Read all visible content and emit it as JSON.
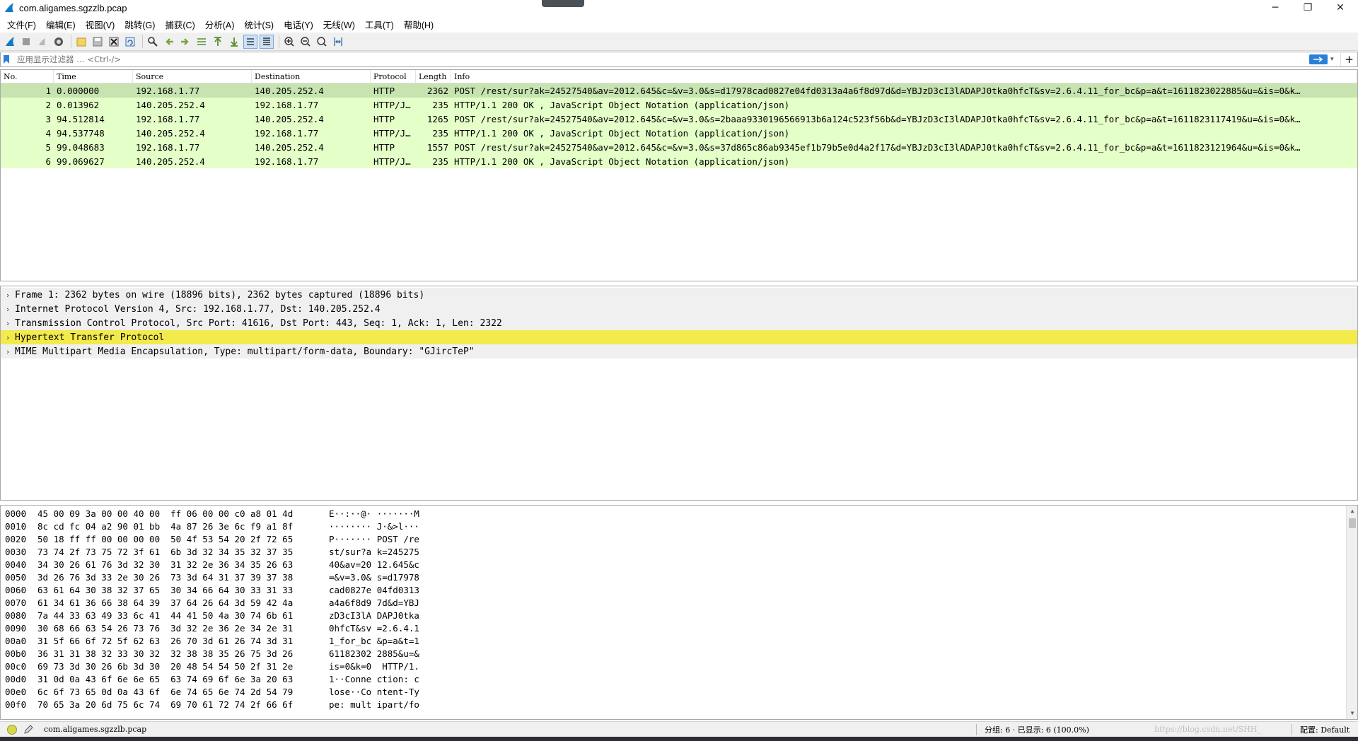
{
  "window": {
    "title": "com.aligames.sgzzlb.pcap",
    "minimize_glyph": "─",
    "restore_glyph": "❐",
    "close_glyph": "✕"
  },
  "menu": [
    "文件(F)",
    "编辑(E)",
    "视图(V)",
    "跳转(G)",
    "捕获(C)",
    "分析(A)",
    "统计(S)",
    "电话(Y)",
    "无线(W)",
    "工具(T)",
    "帮助(H)"
  ],
  "filter": {
    "placeholder": "应用显示过滤器 … <Ctrl-/>",
    "plus": "+"
  },
  "packet_list": {
    "columns": [
      "No.",
      "Time",
      "Source",
      "Destination",
      "Protocol",
      "Length",
      "Info"
    ],
    "rows": [
      {
        "no": "1",
        "time": "0.000000",
        "src": "192.168.1.77",
        "dst": "140.205.252.4",
        "proto": "HTTP",
        "len": "2362",
        "info": "POST /rest/sur?ak=24527540&av=2012.645&c=&v=3.0&s=d17978cad0827e04fd0313a4a6f8d97d&d=YBJzD3cI3lADAPJ0tka0hfcT&sv=2.6.4.11_for_bc&p=a&t=1611823022885&u=&is=0&k…"
      },
      {
        "no": "2",
        "time": "0.013962",
        "src": "140.205.252.4",
        "dst": "192.168.1.77",
        "proto": "HTTP/J…",
        "len": "235",
        "info": "HTTP/1.1 200 OK , JavaScript Object Notation (application/json)"
      },
      {
        "no": "3",
        "time": "94.512814",
        "src": "192.168.1.77",
        "dst": "140.205.252.4",
        "proto": "HTTP",
        "len": "1265",
        "info": "POST /rest/sur?ak=24527540&av=2012.645&c=&v=3.0&s=2baaa9330196566913b6a124c523f56b&d=YBJzD3cI3lADAPJ0tka0hfcT&sv=2.6.4.11_for_bc&p=a&t=1611823117419&u=&is=0&k…"
      },
      {
        "no": "4",
        "time": "94.537748",
        "src": "140.205.252.4",
        "dst": "192.168.1.77",
        "proto": "HTTP/J…",
        "len": "235",
        "info": "HTTP/1.1 200 OK , JavaScript Object Notation (application/json)"
      },
      {
        "no": "5",
        "time": "99.048683",
        "src": "192.168.1.77",
        "dst": "140.205.252.4",
        "proto": "HTTP",
        "len": "1557",
        "info": "POST /rest/sur?ak=24527540&av=2012.645&c=&v=3.0&s=37d865c86ab9345ef1b79b5e0d4a2f17&d=YBJzD3cI3lADAPJ0tka0hfcT&sv=2.6.4.11_for_bc&p=a&t=1611823121964&u=&is=0&k…"
      },
      {
        "no": "6",
        "time": "99.069627",
        "src": "140.205.252.4",
        "dst": "192.168.1.77",
        "proto": "HTTP/J…",
        "len": "235",
        "info": "HTTP/1.1 200 OK , JavaScript Object Notation (application/json)"
      }
    ]
  },
  "details": [
    "Frame 1: 2362 bytes on wire (18896 bits), 2362 bytes captured (18896 bits)",
    "Internet Protocol Version 4, Src: 192.168.1.77, Dst: 140.205.252.4",
    "Transmission Control Protocol, Src Port: 41616, Dst Port: 443, Seq: 1, Ack: 1, Len: 2322",
    "Hypertext Transfer Protocol",
    "MIME Multipart Media Encapsulation, Type: multipart/form-data, Boundary: \"GJircTeP\""
  ],
  "hex": [
    {
      "off": "0000",
      "bytes": "45 00 09 3a 00 00 40 00  ff 06 00 00 c0 a8 01 4d",
      "ascii": "E··:··@· ·······M"
    },
    {
      "off": "0010",
      "bytes": "8c cd fc 04 a2 90 01 bb  4a 87 26 3e 6c f9 a1 8f",
      "ascii": "········ J·&>l···"
    },
    {
      "off": "0020",
      "bytes": "50 18 ff ff 00 00 00 00  50 4f 53 54 20 2f 72 65",
      "ascii": "P······· POST /re"
    },
    {
      "off": "0030",
      "bytes": "73 74 2f 73 75 72 3f 61  6b 3d 32 34 35 32 37 35",
      "ascii": "st/sur?a k=245275"
    },
    {
      "off": "0040",
      "bytes": "34 30 26 61 76 3d 32 30  31 32 2e 36 34 35 26 63",
      "ascii": "40&av=20 12.645&c"
    },
    {
      "off": "0050",
      "bytes": "3d 26 76 3d 33 2e 30 26  73 3d 64 31 37 39 37 38",
      "ascii": "=&v=3.0& s=d17978"
    },
    {
      "off": "0060",
      "bytes": "63 61 64 30 38 32 37 65  30 34 66 64 30 33 31 33",
      "ascii": "cad0827e 04fd0313"
    },
    {
      "off": "0070",
      "bytes": "61 34 61 36 66 38 64 39  37 64 26 64 3d 59 42 4a",
      "ascii": "a4a6f8d9 7d&d=YBJ"
    },
    {
      "off": "0080",
      "bytes": "7a 44 33 63 49 33 6c 41  44 41 50 4a 30 74 6b 61",
      "ascii": "zD3cI3lA DAPJ0tka"
    },
    {
      "off": "0090",
      "bytes": "30 68 66 63 54 26 73 76  3d 32 2e 36 2e 34 2e 31",
      "ascii": "0hfcT&sv =2.6.4.1"
    },
    {
      "off": "00a0",
      "bytes": "31 5f 66 6f 72 5f 62 63  26 70 3d 61 26 74 3d 31",
      "ascii": "1_for_bc &p=a&t=1"
    },
    {
      "off": "00b0",
      "bytes": "36 31 31 38 32 33 30 32  32 38 38 35 26 75 3d 26",
      "ascii": "61182302 2885&u=&"
    },
    {
      "off": "00c0",
      "bytes": "69 73 3d 30 26 6b 3d 30  20 48 54 54 50 2f 31 2e",
      "ascii": "is=0&k=0  HTTP/1."
    },
    {
      "off": "00d0",
      "bytes": "31 0d 0a 43 6f 6e 6e 65  63 74 69 6f 6e 3a 20 63",
      "ascii": "1··Conne ction: c"
    },
    {
      "off": "00e0",
      "bytes": "6c 6f 73 65 0d 0a 43 6f  6e 74 65 6e 74 2d 54 79",
      "ascii": "lose··Co ntent-Ty"
    },
    {
      "off": "00f0",
      "bytes": "70 65 3a 20 6d 75 6c 74  69 70 61 72 74 2f 66 6f",
      "ascii": "pe: mult ipart/fo"
    }
  ],
  "status": {
    "file": "com.aligames.sgzzlb.pcap",
    "stats": "分组: 6 · 已显示: 6 (100.0%)",
    "watermark": "https://blog.csdn.net/SHH_",
    "profile": "配置: Default"
  },
  "colors": {
    "row_bg": "#e4ffc7",
    "row_selected": "#c6e3b0",
    "highlight": "#f3ea4b",
    "apply_button": "#2b7fd7"
  }
}
